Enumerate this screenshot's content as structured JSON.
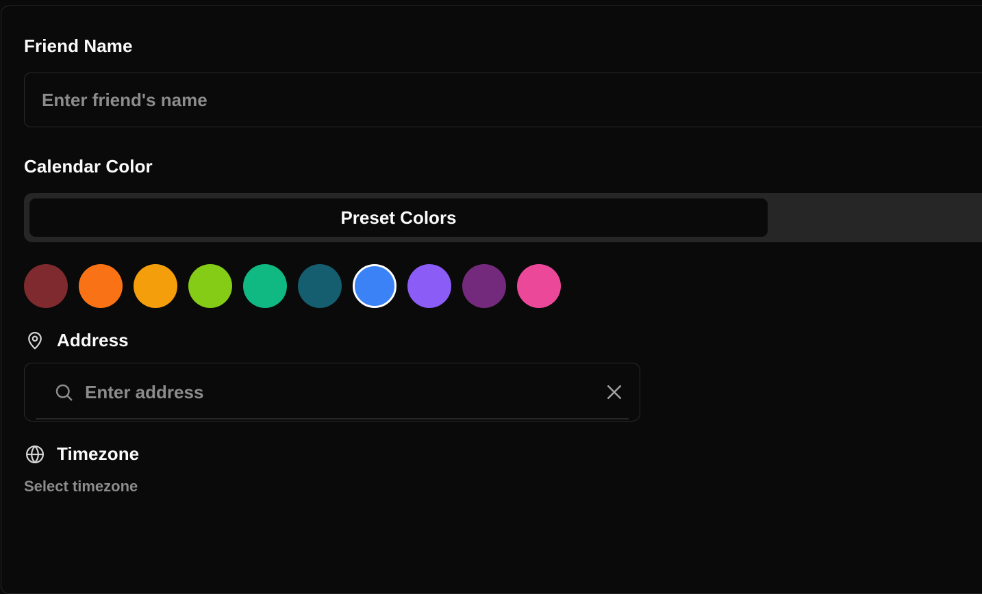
{
  "form": {
    "friend_name_label": "Friend Name",
    "friend_name_placeholder": "Enter friend's name",
    "friend_name_value": "",
    "calendar_color_label": "Calendar Color",
    "color_tabs": [
      {
        "label": "Preset Colors",
        "active": true
      },
      {
        "label": "",
        "active": false
      }
    ],
    "preset_colors": [
      "#7f2a2e",
      "#f97316",
      "#f59e0b",
      "#84cc16",
      "#10b981",
      "#155e6f",
      "#3b82f6",
      "#8b5cf6",
      "#742a7c",
      "#ec4899"
    ],
    "selected_color": "#3b82f6",
    "address_label": "Address",
    "address_icon": "map-pin-icon",
    "address_placeholder": "Enter address",
    "search_icon": "search-icon",
    "clear_icon": "close-icon",
    "timezone_label": "Timezone",
    "timezone_icon": "globe-icon",
    "timezone_value": "Select timezone"
  },
  "theme": {
    "background": "#0a0a0a",
    "border": "#2a2a2a",
    "muted_text": "#8c8c8c",
    "tab_track": "#262626"
  }
}
